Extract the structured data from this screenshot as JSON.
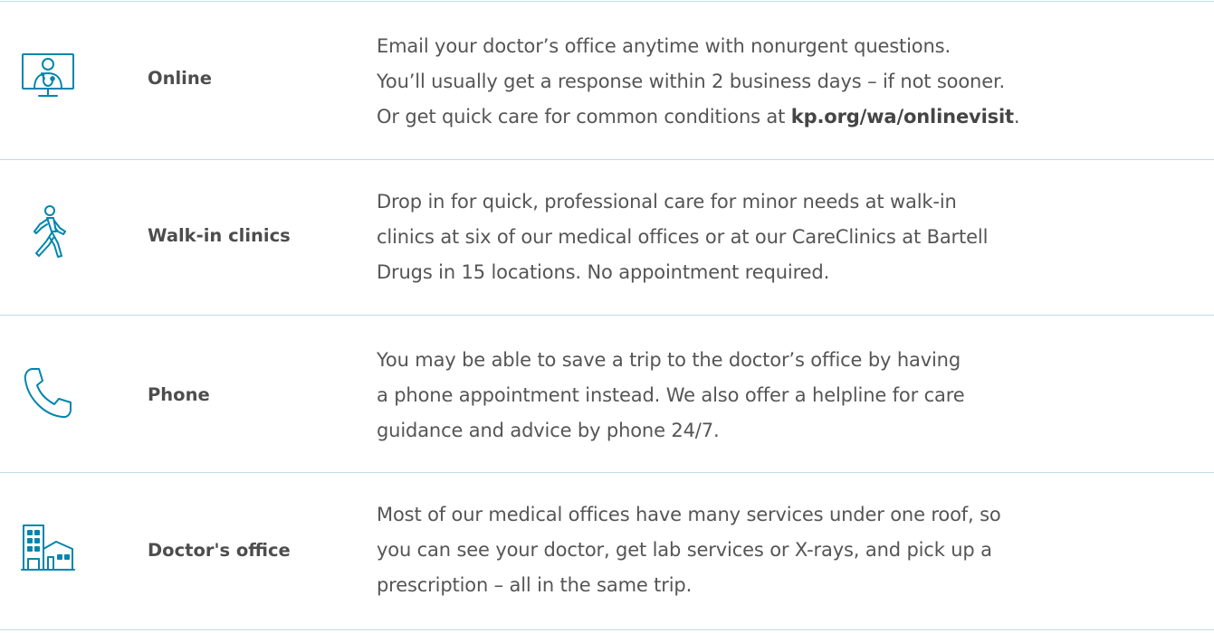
{
  "colors": {
    "accent": "#0085ad",
    "divider": "#bfdde6",
    "text": "#555555",
    "label": "#4d4d4d"
  },
  "rows": [
    {
      "icon": "telehealth-doctor-monitor-icon",
      "label": "Online",
      "desc": {
        "line1": "Email your doctor’s office anytime with nonurgent questions.",
        "line2": "You’ll usually get a response within 2 business days – if not sooner.",
        "line3_pre": "Or get quick care for common conditions at ",
        "line3_link": "kp.org/wa/onlinevisit",
        "line3_post": "."
      }
    },
    {
      "icon": "walking-person-icon",
      "label": "Walk-in clinics",
      "desc": {
        "line1": "Drop in for quick, professional care for minor needs at walk-in",
        "line2": "clinics at six of our medical offices or at our CareClinics at Bartell",
        "line3": "Drugs in 15 locations. No appointment required."
      }
    },
    {
      "icon": "phone-handset-icon",
      "label": "Phone",
      "desc": {
        "line1": "You may be able to save a trip to the doctor’s office by having",
        "line2": "a phone appointment instead. We also offer a helpline for care",
        "line3": "guidance and advice by phone 24/7."
      }
    },
    {
      "icon": "medical-office-building-icon",
      "label": "Doctor's office",
      "desc": {
        "line1": "Most of our medical offices have many services under one roof, so",
        "line2": "you can see your doctor, get lab services or X-rays, and pick up a",
        "line3": "prescription – all in the same trip."
      }
    }
  ]
}
